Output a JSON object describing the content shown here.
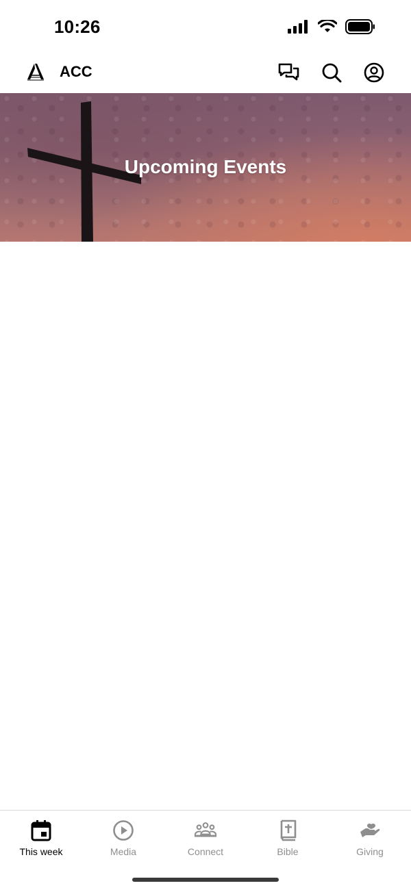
{
  "status_bar": {
    "time": "10:26"
  },
  "header": {
    "title": "ACC",
    "actions": [
      "chat-icon",
      "search-icon",
      "profile-icon"
    ]
  },
  "hero": {
    "title": "Upcoming Events"
  },
  "tabs": [
    {
      "label": "This week",
      "icon": "calendar-icon",
      "active": true
    },
    {
      "label": "Media",
      "icon": "play-icon",
      "active": false
    },
    {
      "label": "Connect",
      "icon": "group-icon",
      "active": false
    },
    {
      "label": "Bible",
      "icon": "bible-icon",
      "active": false
    },
    {
      "label": "Giving",
      "icon": "giving-hand-icon",
      "active": false
    }
  ],
  "colors": {
    "active_tab": "#000000",
    "inactive_tab": "#8e8e8e",
    "hero_sky": "#9a6a72"
  }
}
